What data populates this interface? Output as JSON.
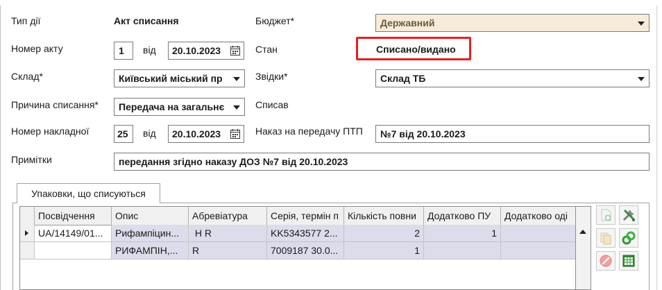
{
  "form": {
    "type_label": "Тип дії",
    "type_value": "Акт списання",
    "budget_label": "Бюджет*",
    "budget_value": "Державний",
    "act_number_label": "Номер акту",
    "act_number_value": "1",
    "from_label_1": "від",
    "act_date_value": "20.10.2023",
    "state_label": "Стан",
    "state_value": "Списано/видано",
    "warehouse_label": "Склад*",
    "warehouse_value": "Київський міський пр",
    "source_label": "Звідки*",
    "source_value": "Склад ТБ",
    "reason_label": "Причина списання*",
    "reason_value": "Передача на загальнє",
    "written_off_label": "Списав",
    "invoice_label": "Номер накладної",
    "invoice_value": "25",
    "from_label_2": "від",
    "invoice_date_value": "20.10.2023",
    "order_label": "Наказ на передачу ПТП",
    "order_value": "№7 від 20.10.2023",
    "notes_label": "Примітки",
    "notes_value": "передання згідно наказу ДОЗ №7 від 20.10.2023"
  },
  "tab": {
    "label": "Упаковки, що списуються"
  },
  "table": {
    "columns": [
      "Посвідчення",
      "Опис",
      "Абревіатура",
      "Серія, термін п",
      "Кількість повни",
      "Додатково ПУ",
      "Додатково оді"
    ],
    "rows": [
      [
        "UA/14149/01...",
        "Рифампіцин...",
        " H R",
        "KK5343577 2...",
        "2",
        "1",
        ""
      ],
      [
        "",
        "РИФАМПІН,...",
        "R",
        "7009187 30.0...",
        "1",
        "",
        ""
      ]
    ]
  },
  "colors": {
    "highlight_frame": "#e81e1e",
    "selected_row": "#dcdceb",
    "budget_bg": "#f6ecd9"
  }
}
